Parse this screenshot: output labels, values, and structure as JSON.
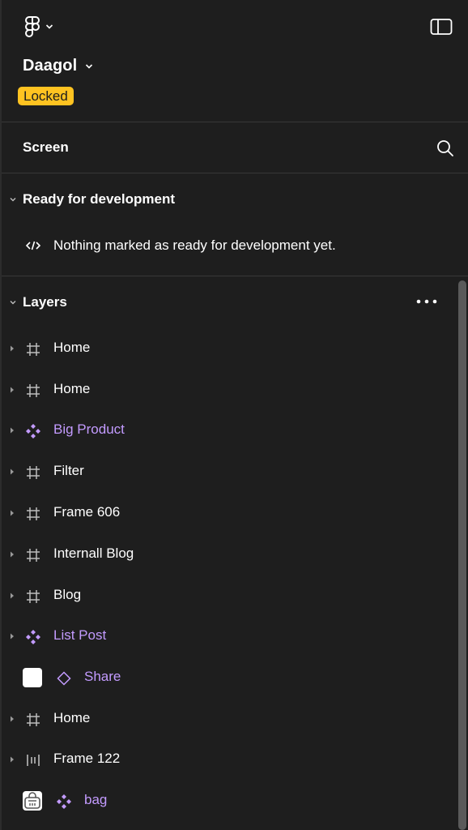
{
  "header": {
    "logo_icon": "figma-logo-icon",
    "logo_menu_icon": "chevron-down-icon",
    "panel_toggle_icon": "sidebar-toggle-icon",
    "file_name": "Daagol",
    "file_menu_icon": "chevron-down-icon",
    "badge": "Locked",
    "badge_color": "#ffc321"
  },
  "screen": {
    "label": "Screen",
    "search_icon": "search-icon"
  },
  "ready_for_dev": {
    "title": "Ready for development",
    "empty_icon": "code-icon",
    "empty_message": "Nothing marked as ready for development yet."
  },
  "layers": {
    "title": "Layers",
    "more_icon": "more-horizontal-icon",
    "items": [
      {
        "label": "Home",
        "icon": "frame-icon",
        "type": "frame"
      },
      {
        "label": "Home",
        "icon": "frame-icon",
        "type": "frame"
      },
      {
        "label": "Big Product",
        "icon": "component-icon",
        "type": "component"
      },
      {
        "label": "Filter",
        "icon": "frame-icon",
        "type": "frame"
      },
      {
        "label": "Frame 606",
        "icon": "frame-icon",
        "type": "frame"
      },
      {
        "label": "Internall Blog",
        "icon": "frame-icon",
        "type": "frame"
      },
      {
        "label": "Blog",
        "icon": "frame-icon",
        "type": "frame"
      },
      {
        "label": "List Post",
        "icon": "component-icon",
        "type": "component"
      },
      {
        "label": "Share",
        "icon": "instance-icon",
        "type": "instance"
      },
      {
        "label": "Home",
        "icon": "frame-icon",
        "type": "frame"
      },
      {
        "label": "Frame 122",
        "icon": "auto-layout-horizontal-icon",
        "type": "frame"
      },
      {
        "label": "bag",
        "icon": "component-icon",
        "type": "component"
      }
    ],
    "component_color": "#c39bff"
  }
}
